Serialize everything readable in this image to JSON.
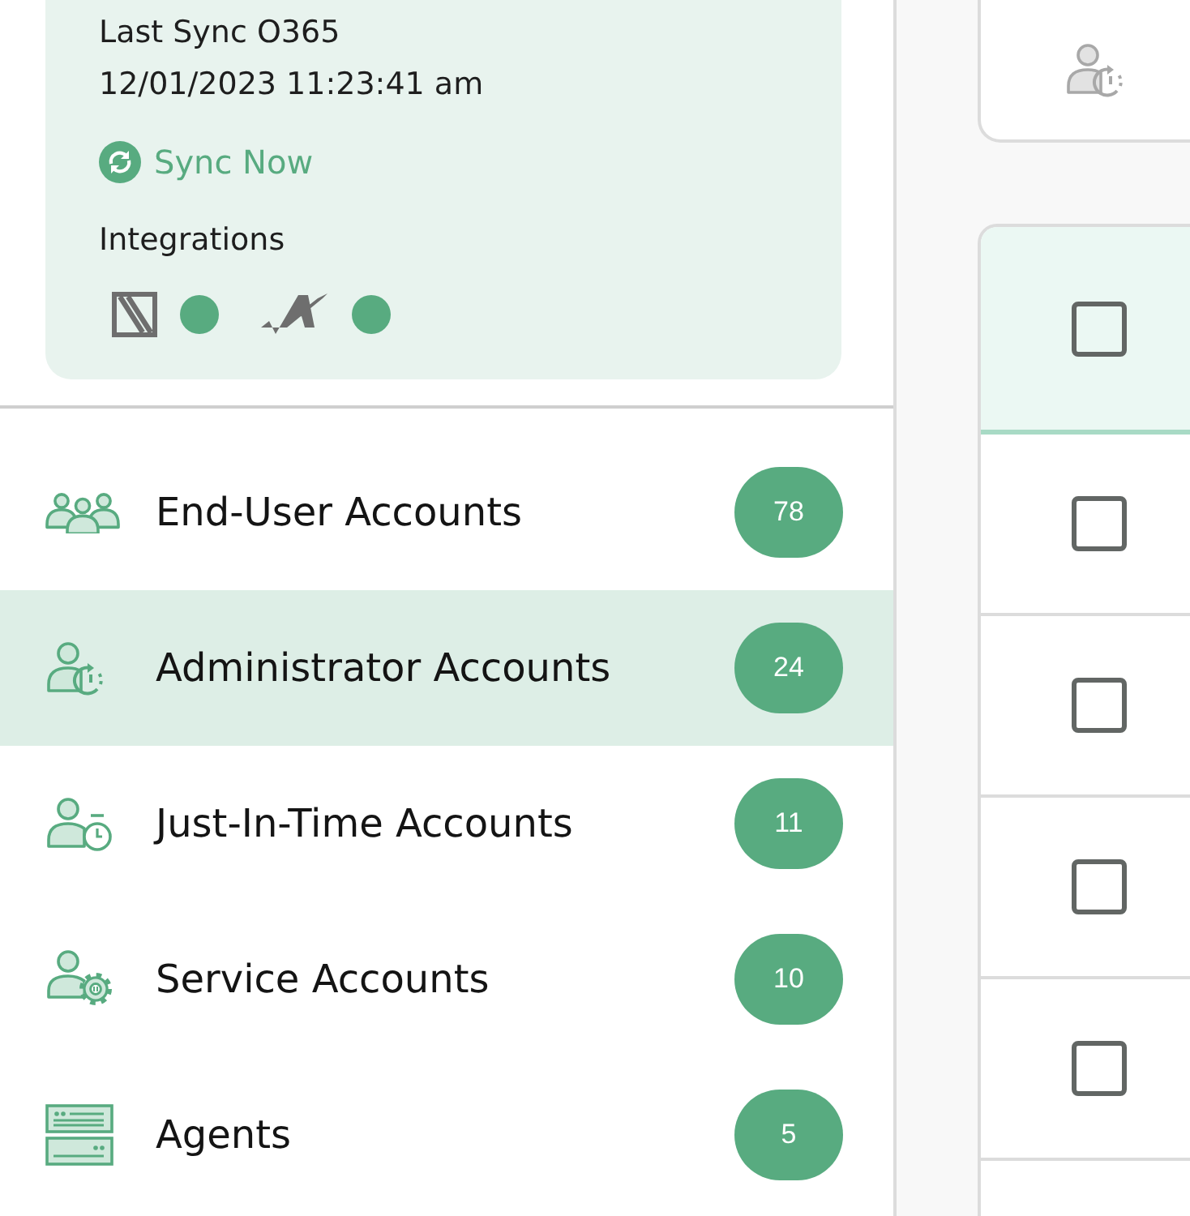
{
  "sync_card": {
    "title": "Last Sync O365",
    "timestamp": "12/01/2023 11:23:41 am",
    "sync_button": "Sync Now",
    "integrations_label": "Integrations",
    "integrations": [
      {
        "kind": "square",
        "connected": true
      },
      {
        "kind": "check",
        "connected": true
      }
    ]
  },
  "nav": {
    "items": [
      {
        "kind": "group",
        "label": "End-User Accounts",
        "count": "78",
        "selected": false
      },
      {
        "kind": "admin",
        "label": "Administrator Accounts",
        "count": "24",
        "selected": true
      },
      {
        "kind": "clock",
        "label": "Just-In-Time Accounts",
        "count": "11",
        "selected": false
      },
      {
        "kind": "service",
        "label": "Service Accounts",
        "count": "10",
        "selected": false
      },
      {
        "kind": "server",
        "label": "Agents",
        "count": "5",
        "selected": false
      }
    ]
  },
  "table": {
    "header": {
      "checked": false
    },
    "rows": [
      {
        "checked": false
      },
      {
        "checked": false
      },
      {
        "checked": false
      },
      {
        "checked": false
      }
    ]
  }
}
